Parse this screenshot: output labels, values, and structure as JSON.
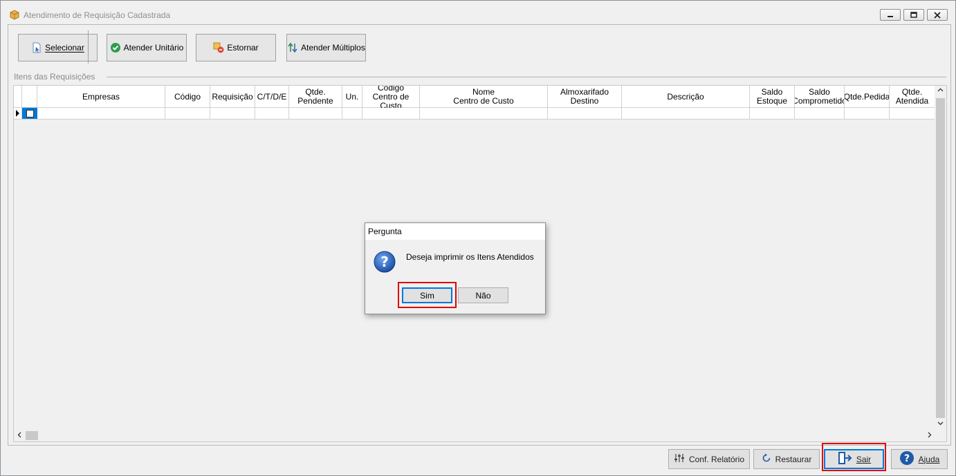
{
  "window": {
    "title": "Atendimento de Requisição Cadastrada",
    "controls": [
      "minimize",
      "restore",
      "close"
    ]
  },
  "toolbar": {
    "buttons": [
      {
        "label": "Selecionar",
        "icon": "select-doc-icon"
      },
      {
        "label": "Atender Unitário",
        "icon": "check-circle-icon"
      },
      {
        "label": "Estornar",
        "icon": "reverse-icon"
      },
      {
        "label": "Atender Múltiplos",
        "icon": "sort-arrows-icon"
      }
    ]
  },
  "grid": {
    "group_label": "Itens das Requisições",
    "columns": [
      "",
      "",
      "Empresas",
      "Código",
      "Requisição",
      "C/T/D/E",
      "Qtde.\nPendente",
      "Un.",
      "Código\nCentro de Custo",
      "Nome\nCentro de Custo",
      "Almoxarifado\nDestino",
      "Descrição",
      "Saldo\nEstoque",
      "Saldo\nComprometido",
      "Qtde.Pedida",
      "Qtde.\nAtendida"
    ]
  },
  "bottom_buttons": [
    {
      "label": "Conf. Relatório",
      "icon": "sliders-icon"
    },
    {
      "label": "Restaurar",
      "icon": "refresh-icon"
    },
    {
      "label": "Sair",
      "icon": "exit-door-icon"
    },
    {
      "label": "Ajuda",
      "icon": "help-icon"
    }
  ],
  "dialog": {
    "title": "Pergunta",
    "message": "Deseja imprimir os Itens Atendidos",
    "yes_label": "Sim",
    "no_label": "Não",
    "icon": "question-icon"
  },
  "colors": {
    "highlight": "#e00000",
    "focus_border": "#0078d7",
    "help_blue": "#1e5aa8"
  }
}
